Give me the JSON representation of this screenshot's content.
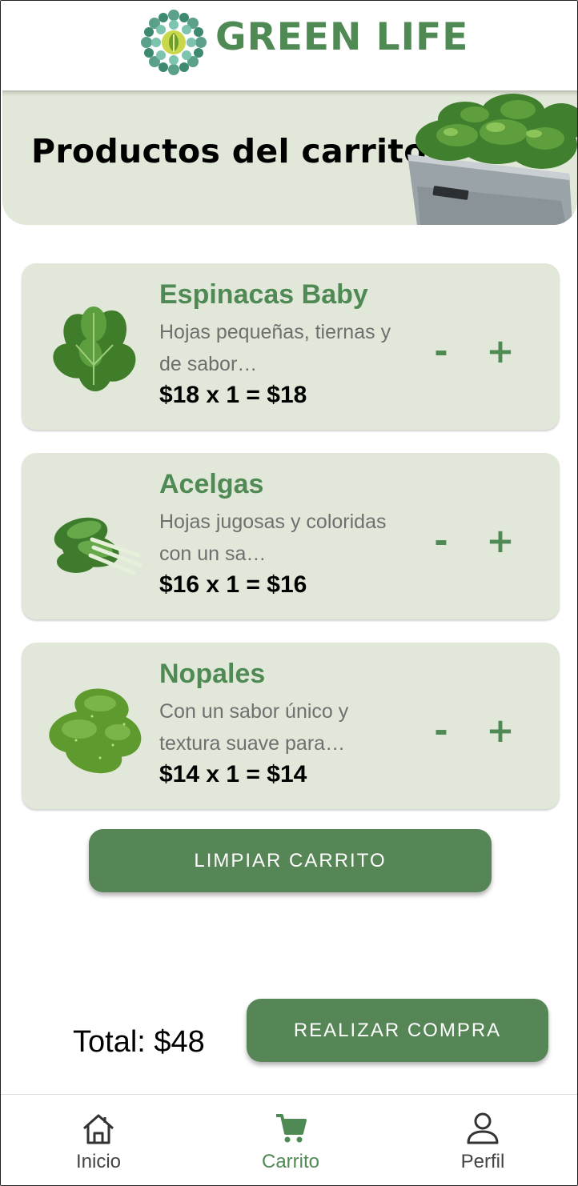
{
  "app": {
    "brand": "GREEN LIFE"
  },
  "banner": {
    "title": "Productos del carrito"
  },
  "cart": {
    "items": [
      {
        "name": "Espinacas Baby",
        "desc": "Hojas pequeñas, tiernas y de sabor…",
        "price": "$18 x 1 = $18",
        "minus": "-",
        "plus": "+"
      },
      {
        "name": "Acelgas",
        "desc": "Hojas jugosas y coloridas con un sa…",
        "price": "$16 x 1 = $16",
        "minus": "-",
        "plus": "+"
      },
      {
        "name": "Nopales",
        "desc": "Con un sabor único y textura suave para…",
        "price": "$14 x 1 = $14",
        "minus": "-",
        "plus": "+"
      }
    ],
    "clear_label": "LIMPIAR CARRITO",
    "total_label": "Total: $48",
    "checkout_label": "REALIZAR COMPRA"
  },
  "nav": {
    "items": [
      {
        "label": "Inicio",
        "icon": "home-icon"
      },
      {
        "label": "Carrito",
        "icon": "cart-icon"
      },
      {
        "label": "Perfil",
        "icon": "user-icon"
      }
    ],
    "active": "Carrito"
  },
  "colors": {
    "accent": "#4f8a55",
    "button": "#568556",
    "card": "#e2e8d9"
  }
}
